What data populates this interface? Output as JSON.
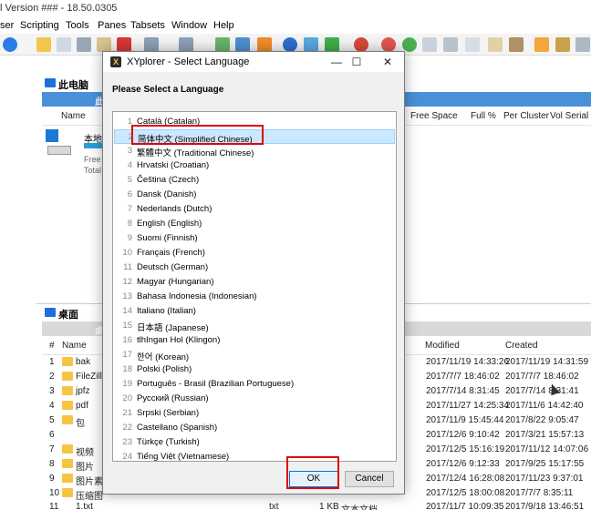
{
  "app": {
    "title": "l Version ### - 18.50.0305",
    "menu": [
      "ser",
      "Scripting",
      "Tools",
      "Panes",
      "Tabsets",
      "Window",
      "Help"
    ]
  },
  "pane_top": {
    "tab_label": "此电脑",
    "address": "此",
    "columns": [
      "Name",
      "Free Space",
      "Full %",
      "Per Cluster",
      "Vol Serial"
    ],
    "drive": {
      "name": "本地",
      "free": "Free",
      "total": "Total"
    }
  },
  "pane_bottom": {
    "tab_label": "桌面",
    "address": "桌",
    "columns": [
      "#",
      "Name",
      "Modified",
      "Created"
    ],
    "rows": [
      {
        "n": "1",
        "name": "bak",
        "modified": "2017/11/19 14:33:26",
        "created": "2017/11/19 14:31:59"
      },
      {
        "n": "2",
        "name": "FileZilla",
        "modified": "2017/7/7 18:46:02",
        "created": "2017/7/7 18:46:02"
      },
      {
        "n": "3",
        "name": "jpfz",
        "modified": "2017/7/14 8:31:45",
        "created": "2017/7/14 8:31:41"
      },
      {
        "n": "4",
        "name": "pdf",
        "modified": "2017/11/27 14:25:34",
        "created": "2017/11/6 14:42:40"
      },
      {
        "n": "5",
        "name": "包",
        "modified": "2017/11/9 15:45:44",
        "created": "2017/8/22 9:05:47"
      },
      {
        "n": "6",
        "name": "",
        "modified": "2017/12/6 9:10:42",
        "created": "2017/3/21 15:57:13"
      },
      {
        "n": "7",
        "name": "视频",
        "modified": "2017/12/5 15:16:19",
        "created": "2017/11/12 14:07:06"
      },
      {
        "n": "8",
        "name": "图片",
        "modified": "2017/12/6 9:12:33",
        "created": "2017/9/25 15:17:55"
      },
      {
        "n": "9",
        "name": "图片素",
        "modified": "2017/12/4 16:28:08",
        "created": "2017/11/23 9:37:01"
      },
      {
        "n": "10",
        "name": "压缩图",
        "modified": "2017/12/5 18:00:08",
        "created": "2017/7/7 8:35:11"
      },
      {
        "n": "11",
        "name": "1.txt",
        "ext": "txt",
        "size": "1 KB",
        "type": "文本文档",
        "modified": "2017/11/7 10:09:35",
        "created": "2017/9/18 13:46:51"
      }
    ]
  },
  "dialog": {
    "title": "XYplorer - Select Language",
    "prompt": "Please Select a Language",
    "selected_index": 1,
    "languages": [
      {
        "n": "1",
        "label": "Català (Catalan)"
      },
      {
        "n": "2",
        "label": "简体中文 (Simplified Chinese)"
      },
      {
        "n": "3",
        "label": "繁體中文 (Traditional Chinese)"
      },
      {
        "n": "4",
        "label": "Hrvatski (Croatian)"
      },
      {
        "n": "5",
        "label": "Čeština (Czech)"
      },
      {
        "n": "6",
        "label": "Dansk (Danish)"
      },
      {
        "n": "7",
        "label": "Nederlands (Dutch)"
      },
      {
        "n": "8",
        "label": "English (English)"
      },
      {
        "n": "9",
        "label": "Suomi (Finnish)"
      },
      {
        "n": "10",
        "label": "Français (French)"
      },
      {
        "n": "11",
        "label": "Deutsch (German)"
      },
      {
        "n": "12",
        "label": "Magyar (Hungarian)"
      },
      {
        "n": "13",
        "label": "Bahasa Indonesia (Indonesian)"
      },
      {
        "n": "14",
        "label": "Italiano (Italian)"
      },
      {
        "n": "15",
        "label": "日本語 (Japanese)"
      },
      {
        "n": "16",
        "label": "tlhIngan Hol (Klingon)"
      },
      {
        "n": "17",
        "label": "한어 (Korean)"
      },
      {
        "n": "18",
        "label": "Polski (Polish)"
      },
      {
        "n": "19",
        "label": "Português - Brasil (Brazilian Portuguese)"
      },
      {
        "n": "20",
        "label": "Русский (Russian)"
      },
      {
        "n": "21",
        "label": "Srpski (Serbian)"
      },
      {
        "n": "22",
        "label": "Castellano (Spanish)"
      },
      {
        "n": "23",
        "label": "Türkçe (Turkish)"
      },
      {
        "n": "24",
        "label": "Tiếng Việt (Vietnamese)"
      }
    ],
    "ok_label": "OK",
    "cancel_label": "Cancel",
    "minimize_glyph": "—",
    "maximize_glyph": "☐",
    "close_glyph": "✕"
  },
  "colors": {
    "highlight": "#e00000",
    "selection": "#cce8ff",
    "address_bar": "#4a90d9"
  }
}
